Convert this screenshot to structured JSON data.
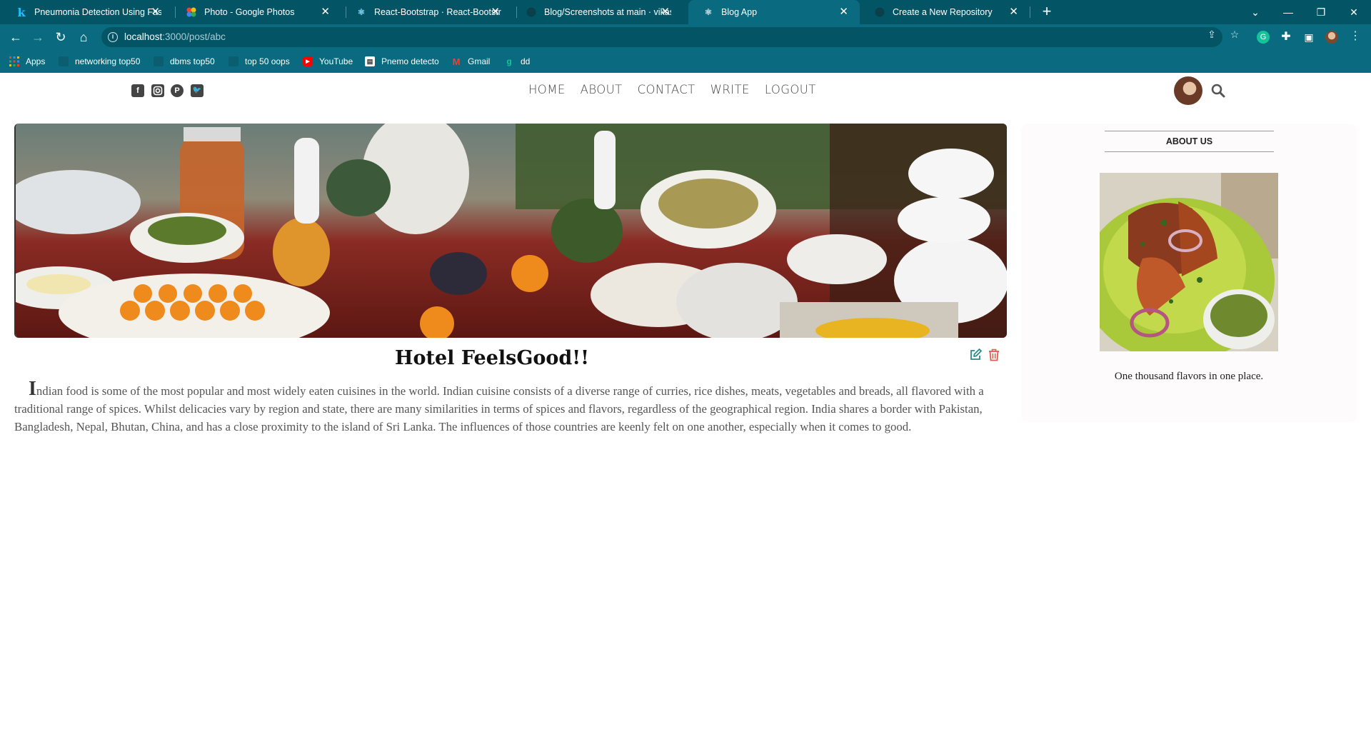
{
  "browser": {
    "tabs": [
      {
        "title": "Pneumonia Detection Using Fast",
        "favicon": "kaggle-icon"
      },
      {
        "title": "Photo - Google Photos",
        "favicon": "google-photos-icon"
      },
      {
        "title": "React-Bootstrap · React-Bootstrap",
        "favicon": "react-bootstrap-icon"
      },
      {
        "title": "Blog/Screenshots at main · vikas",
        "favicon": "github-icon"
      },
      {
        "title": "Blog App",
        "favicon": "react-icon",
        "active": true
      },
      {
        "title": "Create a New Repository",
        "favicon": "github-icon"
      }
    ],
    "address": {
      "host": "localhost",
      "path": ":3000/post/abc"
    },
    "bookmarks": [
      {
        "label": "Apps",
        "icon": "apps-grid-icon"
      },
      {
        "label": "networking top50",
        "icon": "bookmark-page-icon"
      },
      {
        "label": "dbms top50",
        "icon": "bookmark-page-icon"
      },
      {
        "label": "top 50 oops",
        "icon": "bookmark-page-icon"
      },
      {
        "label": "YouTube",
        "icon": "youtube-icon"
      },
      {
        "label": "Pnemo detecto",
        "icon": "document-icon"
      },
      {
        "label": "Gmail",
        "icon": "gmail-icon"
      },
      {
        "label": "dd",
        "icon": "grammarly-icon"
      }
    ]
  },
  "site": {
    "social": [
      "facebook-icon",
      "instagram-icon",
      "pinterest-icon",
      "twitter-icon"
    ],
    "nav": [
      "HOME",
      "ABOUT",
      "CONTACT",
      "WRITE",
      "LOGOUT"
    ]
  },
  "post": {
    "title": "Hotel FeelsGood!!",
    "dropcap": "I",
    "body": "ndian food is some of the most popular and most widely eaten cuisines in the world. Indian cuisine consists of a diverse range of curries, rice dishes, meats, vegetables and breads, all flavored with a traditional range of spices. Whilst delicacies vary by region and state, there are many similarities in terms of spices and flavors, regardless of the geographical region. India shares a border with Pakistan, Bangladesh, Nepal, Bhutan, China, and has a close proximity to the island of Sri Lanka. The influences of those countries are keenly felt on one another, especially when it comes to good."
  },
  "sidebar": {
    "title": "ABOUT US",
    "text": "One thousand flavors in one place."
  },
  "colors": {
    "chrome_tabstrip": "#035566",
    "chrome_toolbar": "#0a6b80",
    "edit_icon": "#2a8a8a",
    "trash_icon": "#e05a4e"
  }
}
